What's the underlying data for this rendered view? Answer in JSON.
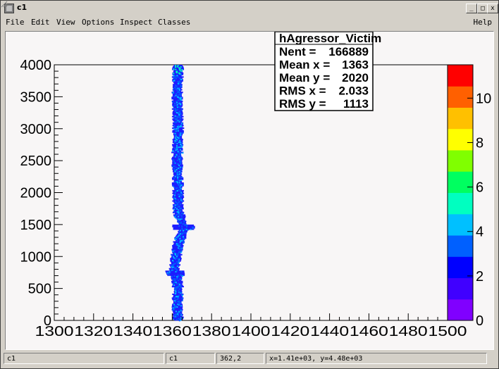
{
  "window": {
    "title": "c1",
    "controls": [
      "_",
      "□",
      "x"
    ]
  },
  "menu": {
    "items": [
      "File",
      "Edit",
      "View",
      "Options",
      "Inspect",
      "Classes"
    ],
    "help": "Help"
  },
  "stats": {
    "name": "hAgressor_Victim",
    "rows": [
      {
        "label": "Nent = ",
        "value": "166889"
      },
      {
        "label": "Mean x = ",
        "value": "1363"
      },
      {
        "label": "Mean y = ",
        "value": "2020"
      },
      {
        "label": "RMS x = ",
        "value": "2.033"
      },
      {
        "label": "RMS y = ",
        "value": "1113"
      }
    ]
  },
  "status": {
    "canvas": "c1",
    "object": "c1",
    "pixel": "362,2",
    "coords": "x=1.41e+03, y=4.48e+03"
  },
  "colors": {
    "canvas_bg": "#f8f6f6",
    "palette": [
      "#8000ff",
      "#4000ff",
      "#0000ff",
      "#0060ff",
      "#00c0ff",
      "#00ffc0",
      "#00ff60",
      "#80ff00",
      "#ffff00",
      "#ffc000",
      "#ff6000",
      "#ff0000"
    ]
  },
  "chart_data": {
    "type": "heatmap",
    "title": "",
    "xlim": [
      1300,
      1500
    ],
    "ylim": [
      0,
      4000
    ],
    "zlim": [
      0,
      11.5
    ],
    "x_ticks": [
      "1300",
      "1320",
      "1340",
      "1360",
      "1380",
      "1400",
      "1420",
      "1440",
      "1460",
      "1480",
      "1500"
    ],
    "y_ticks": [
      "0",
      "500",
      "1000",
      "1500",
      "2000",
      "2500",
      "3000",
      "3500",
      "4000"
    ],
    "z_ticks": [
      "0",
      "2",
      "4",
      "6",
      "8",
      "10"
    ],
    "band": {
      "x_center_profile": [
        [
          0,
          1363
        ],
        [
          200,
          1362.5
        ],
        [
          500,
          1363
        ],
        [
          700,
          1362
        ],
        [
          800,
          1361
        ],
        [
          1000,
          1362
        ],
        [
          1200,
          1363
        ],
        [
          1450,
          1366
        ],
        [
          1700,
          1363
        ],
        [
          2000,
          1363
        ],
        [
          2500,
          1362.5
        ],
        [
          3000,
          1363
        ],
        [
          3500,
          1362.5
        ],
        [
          4000,
          1363
        ]
      ],
      "x_halfwidth": 2.5
    }
  }
}
